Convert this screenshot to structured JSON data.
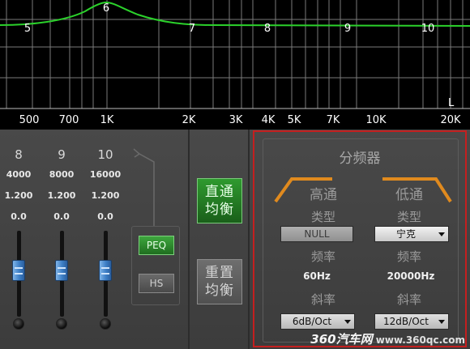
{
  "graph": {
    "band_markers": [
      "5",
      "6",
      "7",
      "8",
      "9",
      "10"
    ],
    "freq_labels": [
      "500",
      "700",
      "1K",
      "2K",
      "3K",
      "4K",
      "5K",
      "7K",
      "10K",
      "20K"
    ],
    "channel_label": "L",
    "curve_color": "#2bd12b"
  },
  "eq": {
    "bands": [
      {
        "num": "8",
        "freq": "4000",
        "q": "1.200",
        "gain": "0.0"
      },
      {
        "num": "9",
        "freq": "8000",
        "q": "1.200",
        "gain": "0.0"
      },
      {
        "num": "10",
        "freq": "16000",
        "q": "1.200",
        "gain": "0.0"
      }
    ],
    "peq_label": "PEQ",
    "hs_label": "HS",
    "direct_label_1": "直通",
    "direct_label_2": "均衡",
    "reset_label_1": "重置",
    "reset_label_2": "均衡"
  },
  "crossover": {
    "title": "分频器",
    "highpass": {
      "name": "高通",
      "type_label": "类型",
      "type_value": "NULL",
      "freq_label": "频率",
      "freq_value": "60Hz",
      "slope_label": "斜率",
      "slope_value": "6dB/Oct"
    },
    "lowpass": {
      "name": "低通",
      "type_label": "类型",
      "type_value": "宁克",
      "freq_label": "频率",
      "freq_value": "20000Hz",
      "slope_label": "斜率",
      "slope_value": "12dB/Oct"
    },
    "accent_color": "#e08a1e",
    "highlight_border": "#c41f1f"
  },
  "watermark": {
    "logo": "360汽车网",
    "url": "www.360qc.com"
  }
}
